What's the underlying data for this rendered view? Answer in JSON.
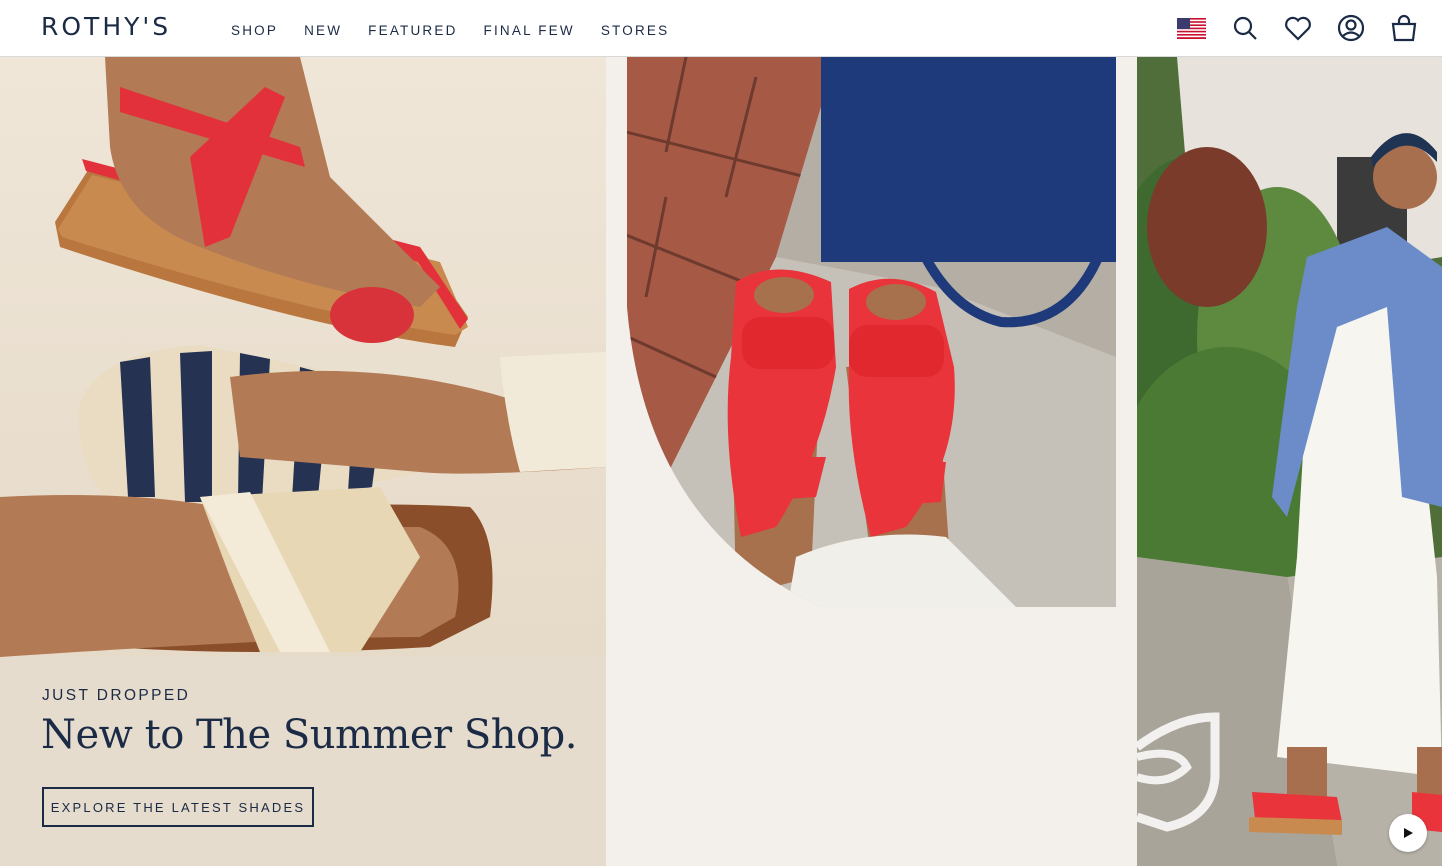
{
  "brand": {
    "logo": "ROTHY'S"
  },
  "nav": {
    "items": [
      {
        "label": "SHOP"
      },
      {
        "label": "NEW"
      },
      {
        "label": "FEATURED"
      },
      {
        "label": "FINAL FEW"
      },
      {
        "label": "STORES"
      }
    ]
  },
  "utility": {
    "icons": [
      "us-flag-icon",
      "search-icon",
      "heart-icon",
      "account-icon",
      "shopping-bag-icon"
    ]
  },
  "hero": {
    "eyebrow": "JUST DROPPED",
    "headline": "New to The Summer Shop.",
    "cta_label": "EXPLORE THE LATEST SHADES"
  },
  "video": {
    "control_icon": "play-icon"
  },
  "colors": {
    "navy": "#1b2a45",
    "sandal_red": "#e8343a",
    "panel_beige": "#ebe1d2",
    "panel_offwhite": "#f3f0ec",
    "tote_blue": "#1f3a7a"
  }
}
